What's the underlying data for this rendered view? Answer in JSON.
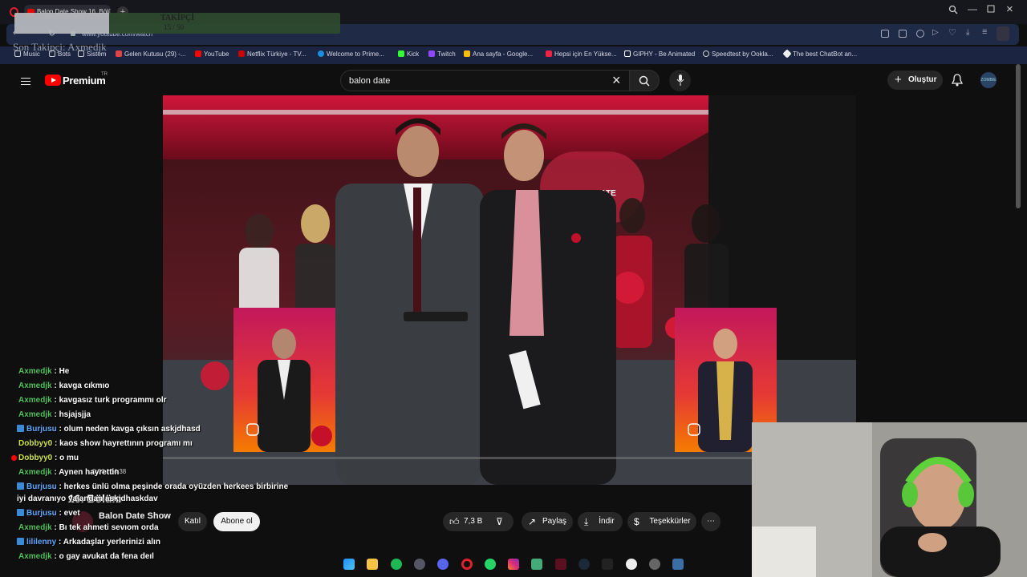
{
  "browser": {
    "tab_title": "Balon Date Show 16. Bölü",
    "url": "www.youtube.com/watch",
    "window_controls": [
      "search-icon",
      "minimize-icon",
      "maximize-icon",
      "close-icon"
    ],
    "bookmarks": [
      {
        "label": "Music",
        "icon": "folder-icon"
      },
      {
        "label": "Bots",
        "icon": "folder-icon"
      },
      {
        "label": "Sistem",
        "icon": "folder-icon"
      },
      {
        "label": "Gelen Kutusu (29) -...",
        "icon": "mail-icon"
      },
      {
        "label": "YouTube",
        "icon": "youtube-icon"
      },
      {
        "label": "Netflix Türkiye - TV...",
        "icon": "netflix-icon"
      },
      {
        "label": "Welcome to Prime...",
        "icon": "prime-icon"
      },
      {
        "label": "Kick",
        "icon": "kick-icon"
      },
      {
        "label": "Twitch",
        "icon": "twitch-icon"
      },
      {
        "label": "Ana sayfa - Google...",
        "icon": "drive-icon"
      },
      {
        "label": "Hepsi için En Yükse...",
        "icon": "bookmark-icon"
      },
      {
        "label": "GIPHY - Be Animated",
        "icon": "giphy-icon"
      },
      {
        "label": "Speedtest by Ookla...",
        "icon": "speedtest-icon"
      },
      {
        "label": "The best ChatBot an...",
        "icon": "chatbot-icon"
      }
    ]
  },
  "overlay": {
    "follower_title": "TAKİPÇİ",
    "follower_count": "15 / 50",
    "last_follower": "Son Takipçi: Axmedjk"
  },
  "youtube": {
    "brand": "Premium",
    "region": "TR",
    "search_value": "balon date",
    "create_label": "Oluştur",
    "avatar_text": "ZOMBIE"
  },
  "video": {
    "timestamp": "0:00 / 34:38",
    "title": "16. Bölüm",
    "channel": "Balon Date Show",
    "join_label": "Katıl",
    "subscribe_label": "Abone ol",
    "likes": "7,3 B",
    "share_label": "Paylaş",
    "download_label": "İndir",
    "thanks_label": "Teşekkürler",
    "sign_text": "BALON DATE SHOW"
  },
  "chat": [
    {
      "user": "Axmedjk",
      "msg": "He",
      "color": "green"
    },
    {
      "user": "Axmedjk",
      "msg": "kavga cıkmıo",
      "color": "green"
    },
    {
      "user": "Axmedjk",
      "msg": "kavgasız turk programmı olr",
      "color": "green"
    },
    {
      "user": "Axmedjk",
      "msg": "hsjajsjja",
      "color": "green"
    },
    {
      "user": "Burjusu",
      "msg": "olum neden kavga çıksın askjdhasd",
      "color": "blue"
    },
    {
      "user": "Dobbyy0",
      "msg": "kaos show hayrettının programı mı",
      "color": "yellow"
    },
    {
      "user": "Dobbyy0",
      "msg": "o mu",
      "color": "yellow"
    },
    {
      "user": "Axmedjk",
      "msg": "Aynen hayrettin",
      "color": "green"
    },
    {
      "user": "Burjusu",
      "msg": "herkes ünlü olma peşinde orada oyüzden herkees birbirine",
      "color": "blue"
    },
    {
      "user": "",
      "msg": "iyi davranıyo yalandan askjdhaskdav",
      "color": "white"
    },
    {
      "user": "Burjusu",
      "msg": "evet",
      "color": "blue"
    },
    {
      "user": "Axmedjk",
      "msg": "Bı tek ahmeti sevıom orda",
      "color": "green"
    },
    {
      "user": "lililenny",
      "msg": "Arkadaşlar yerlerinizi alın",
      "color": "blue"
    },
    {
      "user": "Axmedjk",
      "msg": "o gay avukat da fena deıl",
      "color": "green"
    }
  ],
  "colors": {
    "accent": "#ff0000",
    "chat_green": "#4fc25a",
    "chat_blue": "#5ea8ff",
    "chat_yellow": "#cfe34a"
  }
}
